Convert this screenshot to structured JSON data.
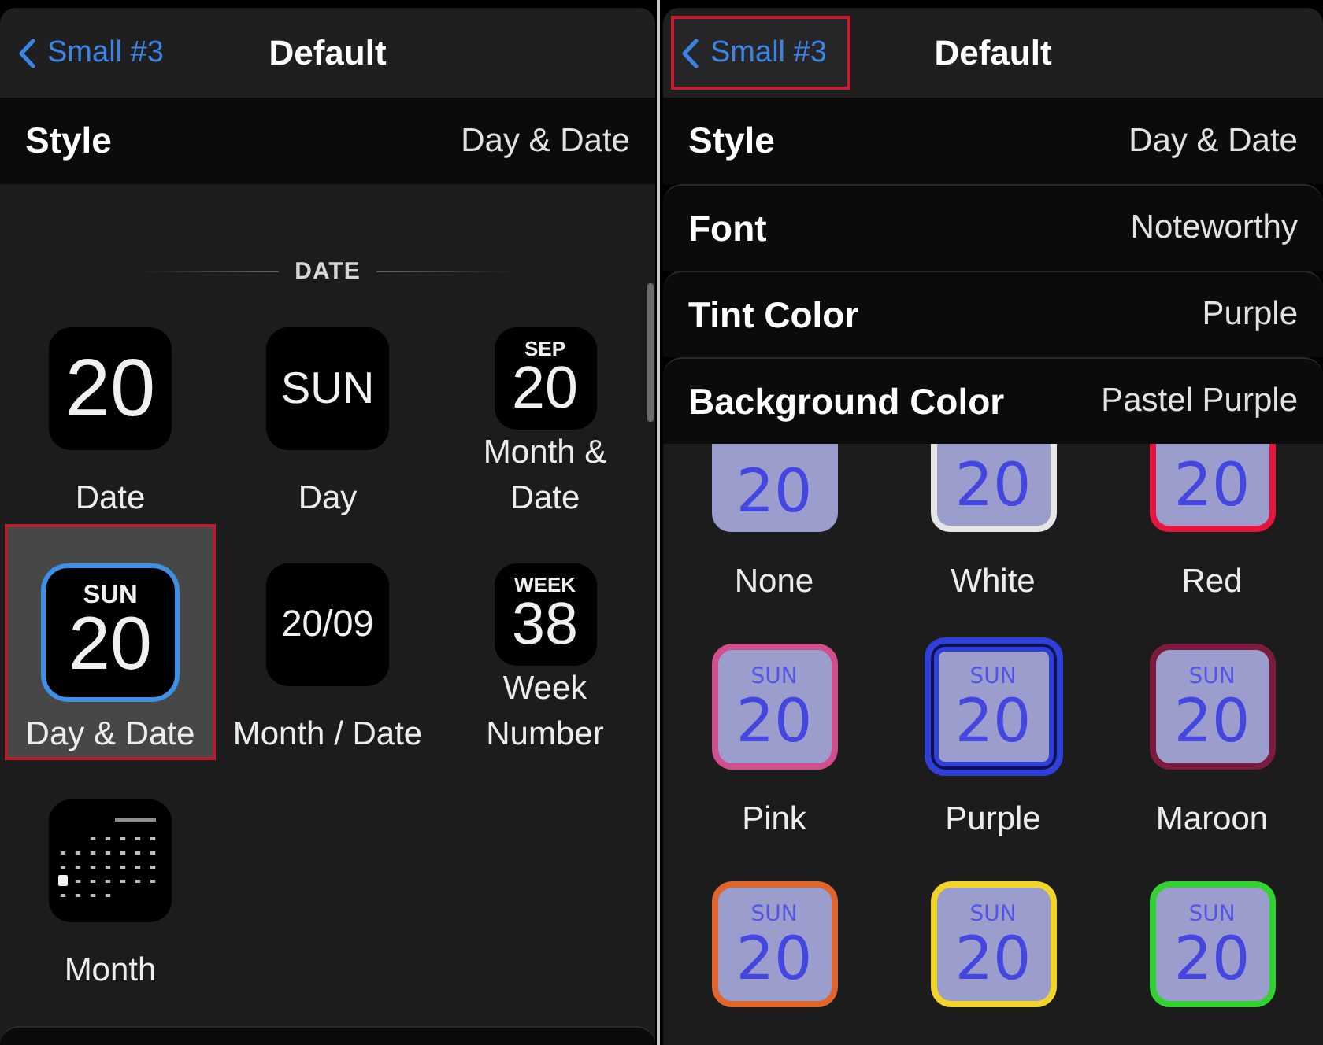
{
  "left_screen": {
    "nav_bar": {
      "back": "Small #3",
      "title": "Default",
      "annotated": false
    },
    "settings": [
      {
        "label": "Style",
        "value": "Day & Date"
      }
    ],
    "section_header": "DATE",
    "style_options": [
      {
        "kind": "number",
        "text": "20",
        "label": "Date",
        "selected": false,
        "annotated": false
      },
      {
        "kind": "word",
        "text": "SUN",
        "label": "Day",
        "selected": false,
        "annotated": false
      },
      {
        "kind": "stacked",
        "caption": "SEP",
        "text": "20",
        "label": "Month & Date",
        "selected": false,
        "annotated": false
      },
      {
        "kind": "stacked",
        "caption": "SUN",
        "text": "20",
        "label": "Day & Date",
        "selected": true,
        "annotated": true
      },
      {
        "kind": "short",
        "text": "20/09",
        "label": "Month / Date",
        "selected": false,
        "annotated": false
      },
      {
        "kind": "stacked",
        "caption": "WEEK",
        "text": "38",
        "label": "Week Number",
        "selected": false,
        "annotated": false
      },
      {
        "kind": "calendar",
        "label": "Month",
        "selected": false,
        "annotated": false
      }
    ]
  },
  "right_screen": {
    "nav_bar": {
      "back": "Small #3",
      "title": "Default",
      "annotated": true
    },
    "settings": [
      {
        "label": "Style",
        "value": "Day & Date"
      },
      {
        "label": "Font",
        "value": "Noteworthy"
      },
      {
        "label": "Tint Color",
        "value": "Purple"
      },
      {
        "label": "Background Color",
        "value": "Pastel Purple"
      }
    ],
    "tint_options": [
      {
        "date": "20",
        "label": "None",
        "selected": false
      },
      {
        "date": "20",
        "label": "White",
        "color": "#e6e6e6",
        "selected": false
      },
      {
        "date": "20",
        "label": "Red",
        "color": "#e2163e",
        "selected": false
      },
      {
        "day": "SUN",
        "date": "20",
        "label": "Pink",
        "color": "#d24f8d",
        "selected": false
      },
      {
        "day": "SUN",
        "date": "20",
        "label": "Purple",
        "color": "#2f3fd8",
        "selected": true
      },
      {
        "day": "SUN",
        "date": "20",
        "label": "Maroon",
        "color": "#7c1b3d",
        "selected": false
      },
      {
        "day": "SUN",
        "date": "20",
        "color": "#e0642c",
        "selected": false
      },
      {
        "day": "SUN",
        "date": "20",
        "color": "#f2d42a",
        "selected": false
      },
      {
        "day": "SUN",
        "date": "20",
        "color": "#33d233",
        "selected": false
      }
    ]
  }
}
